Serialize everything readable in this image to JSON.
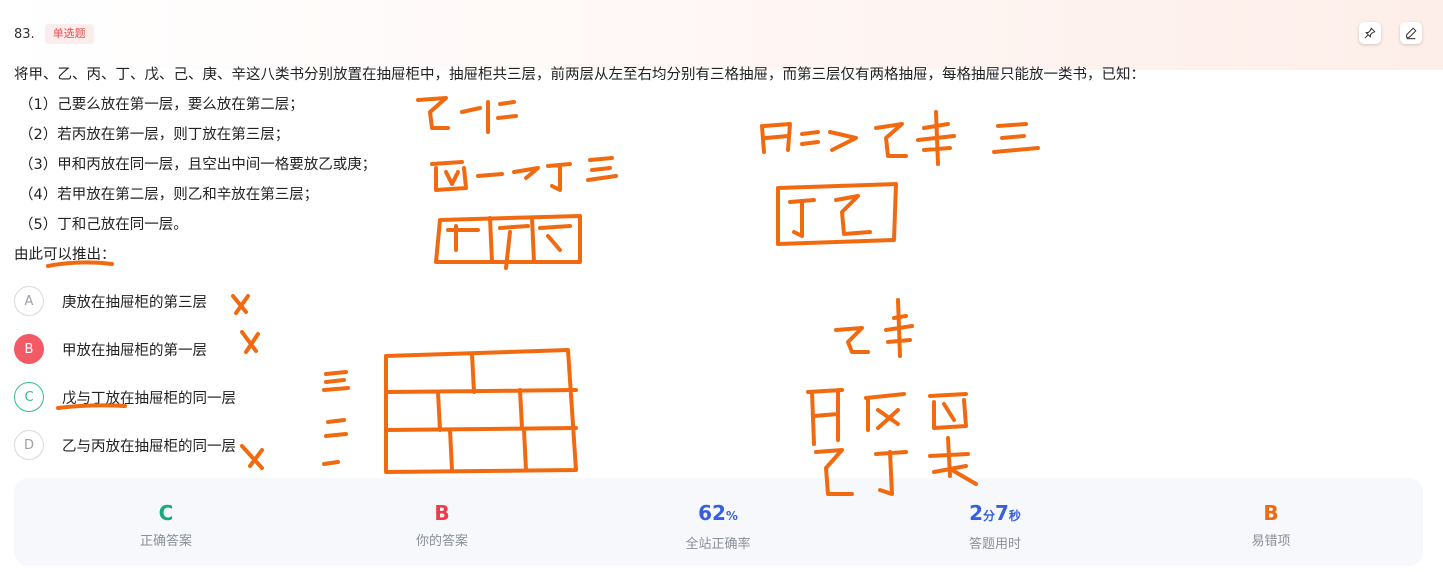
{
  "question": {
    "number": "83.",
    "type_badge": "单选题",
    "stem": "将甲、乙、丙、丁、戊、己、庚、辛这八类书分别放置在抽屉柜中，抽屉柜共三层，前两层从左至右均分别有三格抽屉，而第三层仅有两格抽屉，每格抽屉只能放一类书，已知：",
    "conditions": [
      "（1）己要么放在第一层，要么放在第二层；",
      "（2）若丙放在第一层，则丁放在第三层；",
      "（3）甲和丙放在同一层，且空出中间一格要放乙或庚；",
      "（4）若甲放在第二层，则乙和辛放在第三层；",
      "（5）丁和己放在同一层。"
    ],
    "prompt": "由此可以推出："
  },
  "options": [
    {
      "letter": "A",
      "text": "庚放在抽屉柜的第三层",
      "state": "normal"
    },
    {
      "letter": "B",
      "text": "甲放在抽屉柜的第一层",
      "state": "selected-wrong"
    },
    {
      "letter": "C",
      "text": "戊与丁放在抽屉柜的同一层",
      "state": "correct"
    },
    {
      "letter": "D",
      "text": "乙与丙放在抽屉柜的同一层",
      "state": "normal"
    }
  ],
  "toolbar": {
    "pin_icon": "pin-icon",
    "edit_icon": "pencil-icon"
  },
  "stats": {
    "correct_answer": {
      "value": "C",
      "label": "正确答案",
      "color": "#1aa97a"
    },
    "your_answer": {
      "value": "B",
      "label": "你的答案",
      "color": "#f0394a"
    },
    "accuracy": {
      "value": "62",
      "unit": "%",
      "label": "全站正确率",
      "color": "#3561e0"
    },
    "time_used": {
      "min": "2",
      "min_unit": "分",
      "sec": "7",
      "sec_unit": "秒",
      "label": "答题用时",
      "color": "#3561e0"
    },
    "common_wrong": {
      "value": "B",
      "label": "易错项",
      "color": "#f26a10"
    }
  },
  "colors": {
    "ink": "#f26a10",
    "accent_red": "#f25b66",
    "accent_green": "#2fbf8e"
  }
}
